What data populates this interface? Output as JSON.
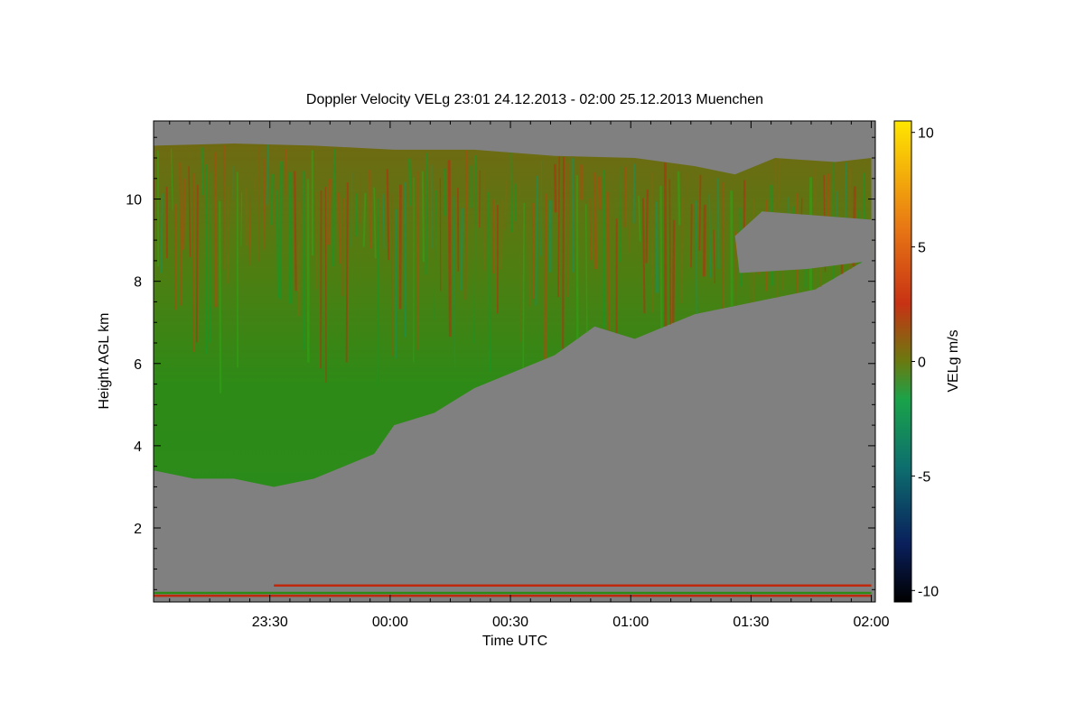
{
  "chart_data": {
    "type": "heatmap",
    "title": "Doppler Velocity VELg   23:01 24.12.2013 - 02:00 25.12.2013 Muenchen",
    "xlabel": "Time UTC",
    "ylabel": "Height AGL km",
    "x_ticks": [
      "23:30",
      "00:00",
      "00:30",
      "01:00",
      "01:30",
      "02:00"
    ],
    "x_tick_minutes": [
      29,
      59,
      89,
      119,
      149,
      179
    ],
    "x_range_minutes": [
      0,
      180
    ],
    "x_start_time": "23:01",
    "x_end_time": "02:00",
    "ylim": [
      0.2,
      11.9
    ],
    "y_ticks": [
      2,
      4,
      6,
      8,
      10
    ],
    "colorbar": {
      "label": "VELg m/s",
      "range": [
        -10.5,
        10.5
      ],
      "ticks": [
        10,
        5,
        0,
        -5,
        -10
      ],
      "colors": [
        "#000000",
        "#0a1f5c",
        "#0d6e6e",
        "#1aa34a",
        "#0c9a0c",
        "#6a7a10",
        "#c83214",
        "#e87814",
        "#ffe600"
      ]
    },
    "background_color": "#808080",
    "cloud_top_km": [
      [
        0,
        11.3
      ],
      [
        20,
        11.35
      ],
      [
        40,
        11.3
      ],
      [
        60,
        11.2
      ],
      [
        80,
        11.2
      ],
      [
        100,
        11.05
      ],
      [
        120,
        11.0
      ],
      [
        135,
        10.8
      ],
      [
        145,
        10.6
      ],
      [
        155,
        11.0
      ],
      [
        170,
        10.9
      ],
      [
        179,
        11.0
      ]
    ],
    "cloud_base_km": [
      [
        0,
        3.4
      ],
      [
        10,
        3.2
      ],
      [
        20,
        3.2
      ],
      [
        30,
        3.0
      ],
      [
        40,
        3.2
      ],
      [
        55,
        3.8
      ],
      [
        60,
        4.5
      ],
      [
        70,
        4.8
      ],
      [
        80,
        5.4
      ],
      [
        90,
        5.8
      ],
      [
        100,
        6.2
      ],
      [
        110,
        6.9
      ],
      [
        120,
        6.6
      ],
      [
        135,
        7.2
      ],
      [
        145,
        7.4
      ],
      [
        155,
        7.6
      ],
      [
        165,
        7.8
      ],
      [
        179,
        8.6
      ]
    ],
    "clear_gap_km": {
      "start_minute": 145,
      "end_minute": 179,
      "low": 8.2,
      "high": 9.7
    },
    "boundary_layer_lines_km": [
      0.6,
      0.42,
      0.35
    ]
  }
}
